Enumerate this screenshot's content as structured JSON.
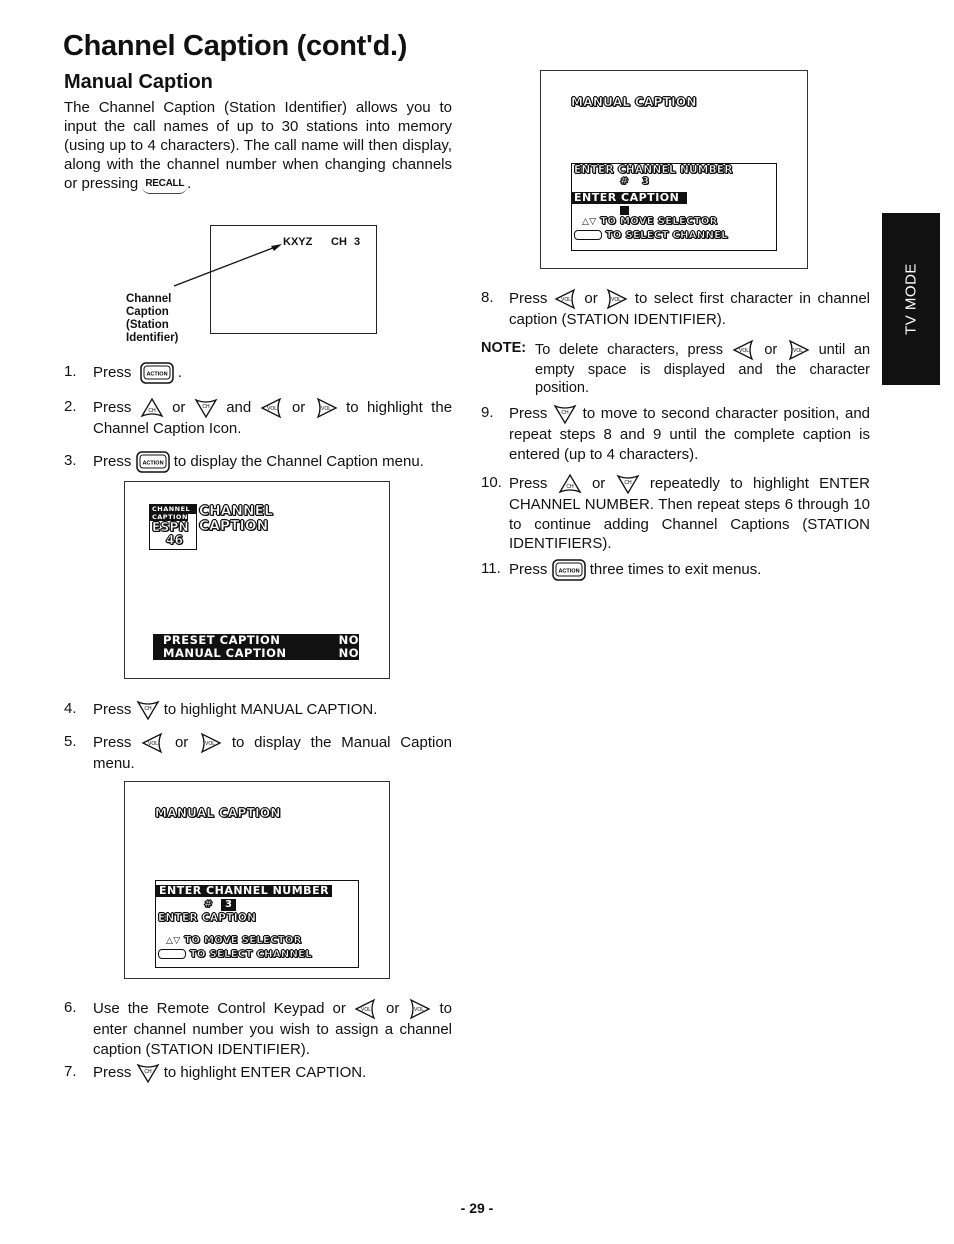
{
  "page": {
    "title": "Channel Caption (cont'd.)",
    "subtitle": "Manual Caption",
    "intro": "The Channel Caption (Station Identifier) allows you to input the call names of up to 30 stations into memory (using up to 4 characters). The call name will then display, along with the channel number when changing channels or pressing",
    "intro_key": "RECALL",
    "intro_end": ".",
    "page_number": "- 29 -",
    "side_tab": "TV MODE"
  },
  "keys": {
    "action": "ACTION",
    "ch": "CH",
    "vol": "VOL"
  },
  "diagram1": {
    "station": "KXYZ",
    "channel": "CH 3",
    "label_lines": [
      "Channel",
      "Caption",
      "(Station",
      "Identifier)"
    ]
  },
  "words": {
    "or": "or",
    "and": "and",
    "press": "Press"
  },
  "steps_left": [
    {
      "num": "1.",
      "pre": "Press",
      "post": "."
    },
    {
      "num": "2.",
      "pre": "Press",
      "post": "to highlight the Channel Caption Icon."
    },
    {
      "num": "3.",
      "pre": "Press",
      "post": "to display the Channel Caption menu."
    },
    {
      "num": "4.",
      "pre": "Press",
      "post": "to highlight MANUAL CAPTION."
    },
    {
      "num": "5.",
      "pre": "Press",
      "post": "to display the Manual Caption menu."
    },
    {
      "num": "6.",
      "pre": "Use the Remote Control Keypad or",
      "post": "to enter channel number you wish to assign a channel caption (STATION IDENTIFIER)."
    },
    {
      "num": "7.",
      "pre": "Press",
      "post": "to highlight ENTER CAPTION."
    }
  ],
  "steps_right": [
    {
      "num": "8.",
      "pre": "Press",
      "post": "to select first character in channel caption (STATION IDENTIFIER)."
    },
    {
      "num": "9.",
      "pre": "Press",
      "post": "to move to second character position, and repeat steps 8 and 9 until the complete caption is entered (up to 4 characters)."
    },
    {
      "num": "10.",
      "pre": "Press",
      "post": "repeatedly to highlight ENTER CHANNEL NUMBER. Then repeat steps 6 through 10 to continue adding Channel Captions (STATION IDENTIFIERS)."
    },
    {
      "num": "11.",
      "pre": "Press",
      "post": "three times to exit menus."
    }
  ],
  "note": {
    "label": "NOTE:",
    "pre": "To delete characters, press",
    "post": "until an empty space is displayed and the character position."
  },
  "screen_channel_caption": {
    "icon_line1": "CHANNEL",
    "icon_line2": "CAPTION",
    "icon_station": "ESPN",
    "icon_channel": "46",
    "heading_line1": "CHANNEL",
    "heading_line2": "CAPTION",
    "rows": [
      {
        "label": "PRESET CAPTION",
        "value": "NO"
      },
      {
        "label": "MANUAL CAPTION",
        "value": "NO"
      }
    ]
  },
  "screen_manual_1": {
    "heading": "MANUAL CAPTION",
    "enter_channel": "ENTER CHANNEL NUMBER",
    "hash": "#",
    "channel_value": "3",
    "enter_caption": "ENTER CAPTION",
    "hint1": "TO MOVE SELECTOR",
    "hint2": "TO SELECT CHANNEL",
    "highlighted": "ENTER CHANNEL NUMBER"
  },
  "screen_manual_2": {
    "heading": "MANUAL CAPTION",
    "enter_channel": "ENTER CHANNEL NUMBER",
    "hash": "#",
    "channel_value": "3",
    "enter_caption": "ENTER CAPTION",
    "hint1": "TO MOVE SELECTOR",
    "hint2": "TO SELECT CHANNEL",
    "highlighted": "ENTER CAPTION"
  }
}
